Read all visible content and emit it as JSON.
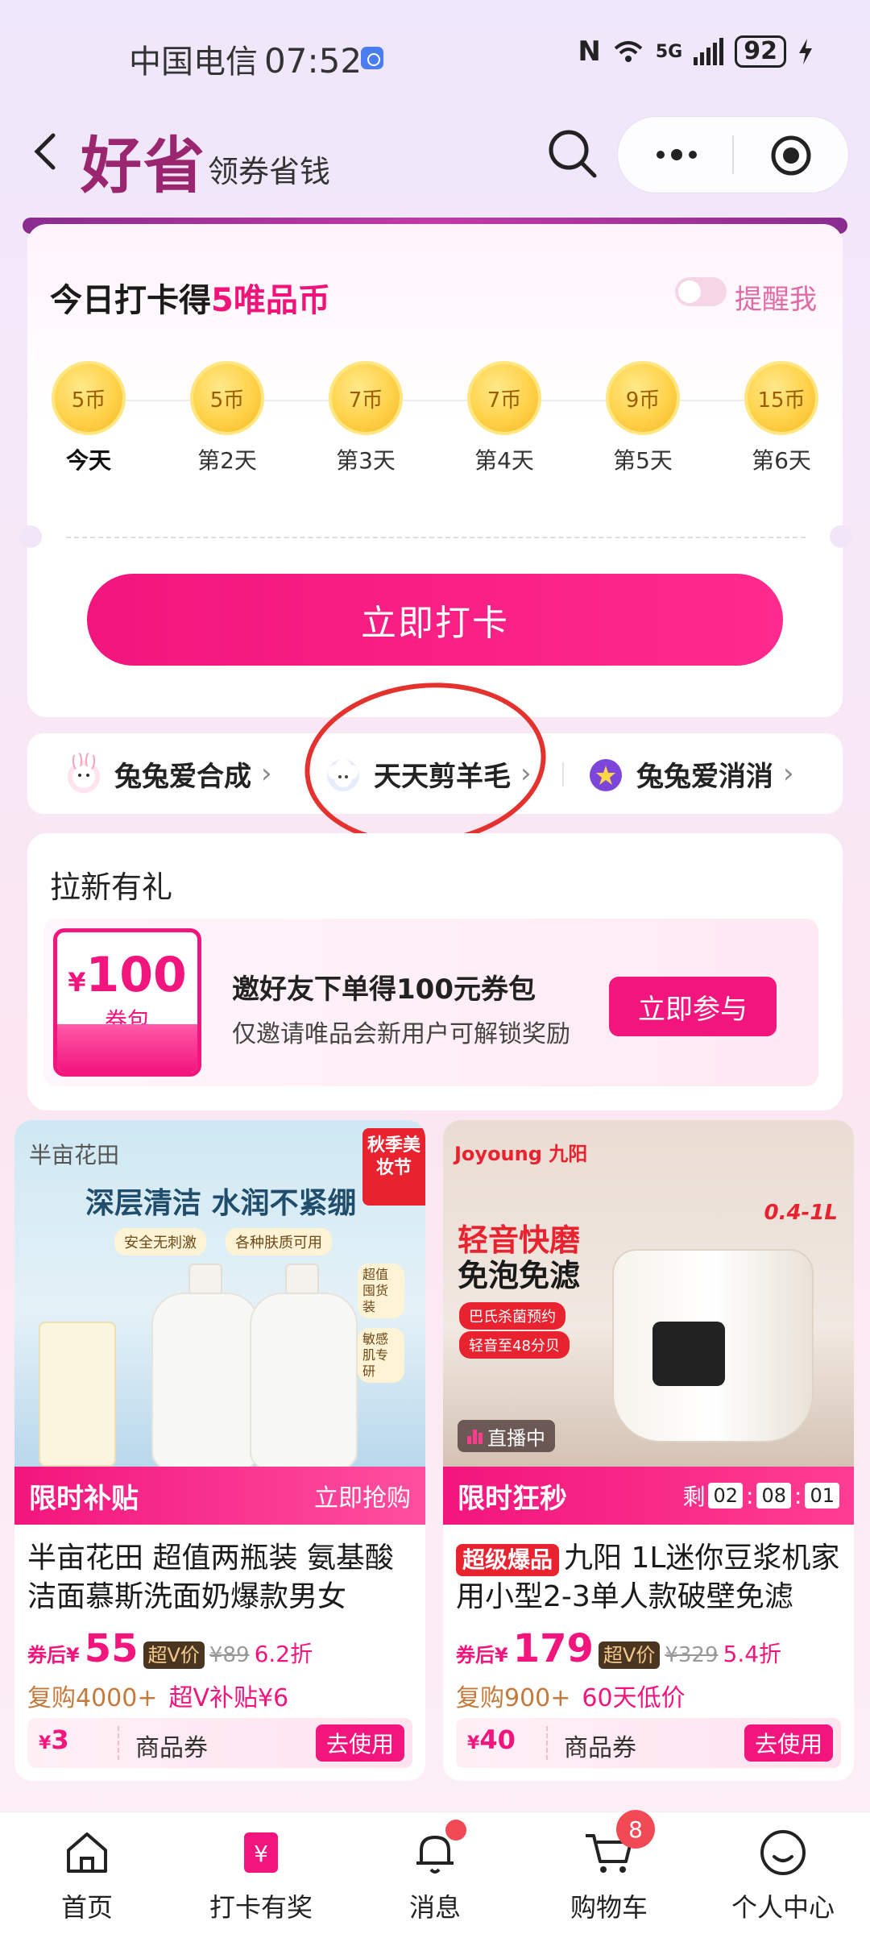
{
  "status_bar": {
    "carrier": "中国电信",
    "time": "07:52",
    "network": "5G",
    "battery": "92"
  },
  "header": {
    "brand": "好省",
    "subtitle": "领券省钱"
  },
  "checkin": {
    "title_prefix": "今日打卡得",
    "title_highlight": "5唯品币",
    "remind_label": "提醒我",
    "days": [
      {
        "coins": "5币",
        "label": "今天"
      },
      {
        "coins": "5币",
        "label": "第2天"
      },
      {
        "coins": "7币",
        "label": "第3天"
      },
      {
        "coins": "7币",
        "label": "第4天"
      },
      {
        "coins": "9币",
        "label": "第5天"
      },
      {
        "coins": "15币",
        "label": "第6天"
      }
    ],
    "button_label": "立即打卡"
  },
  "games": [
    {
      "label": "兔兔爱合成",
      "icon": "bunny-icon"
    },
    {
      "label": "天天剪羊毛",
      "icon": "sheep-icon"
    },
    {
      "label": "兔兔爱消消",
      "icon": "star-ball-icon"
    }
  ],
  "referral": {
    "title": "拉新有礼",
    "coupon_yen": "¥",
    "coupon_amount": "100",
    "coupon_unit": "券包",
    "main_text": "邀好友下单得100元券包",
    "sub_text": "仅邀请唯品会新用户可解锁奖励",
    "button_label": "立即参与"
  },
  "products": [
    {
      "image": {
        "brand": "半亩花田",
        "headline": "深层清洁 水润不紧绷",
        "chips": [
          "安全无刺激",
          "各种肤质可用"
        ],
        "side_tags": [
          "超值囤货装",
          "敏感肌专研"
        ],
        "badge": "秋季美妆节"
      },
      "promo_left": "限时补贴",
      "promo_right": "立即抢购",
      "title": "半亩花田 超值两瓶装 氨基酸洁面慕斯洗面奶爆款男女",
      "price_prefix": "券后¥",
      "price": "55",
      "v_tag": "超V价",
      "original_price": "¥89",
      "discount": "6.2折",
      "sub_left": "复购4000+",
      "sub_right": "超V补贴¥6",
      "coupon_yen": "¥",
      "coupon_amount": "3",
      "coupon_label": "商品券",
      "coupon_button": "去使用"
    },
    {
      "image": {
        "brand": "Joyoung 九阳",
        "headline_red": "轻音快磨",
        "headline_black": "免泡免滤",
        "pills": [
          "巴氏杀菌预约",
          "轻音至48分贝"
        ],
        "capacity": "0.4-1L",
        "live_label": "直播中"
      },
      "promo_left": "限时狂秒",
      "timer_prefix": "剩",
      "timer": [
        "02",
        "08",
        "01"
      ],
      "hot_tag": "超级爆品",
      "title": "九阳 1L迷你豆浆机家用小型2-3单人款破壁免滤",
      "price_prefix": "券后¥",
      "price": "179",
      "v_tag": "超V价",
      "original_price": "¥329",
      "discount": "5.4折",
      "sub_left": "复购900+",
      "sub_right": "60天低价",
      "coupon_yen": "¥",
      "coupon_amount": "40",
      "coupon_label": "商品券",
      "coupon_button": "去使用"
    }
  ],
  "bottom_nav": [
    {
      "label": "首页",
      "icon": "home-icon"
    },
    {
      "label": "打卡有奖",
      "icon": "yen-tag-icon"
    },
    {
      "label": "消息",
      "icon": "bell-icon"
    },
    {
      "label": "购物车",
      "icon": "cart-icon",
      "badge": "8"
    },
    {
      "label": "个人中心",
      "icon": "smile-icon"
    }
  ],
  "colors": {
    "accent": "#f2157d",
    "brand": "#9b2670",
    "annotation": "#e4322e"
  }
}
